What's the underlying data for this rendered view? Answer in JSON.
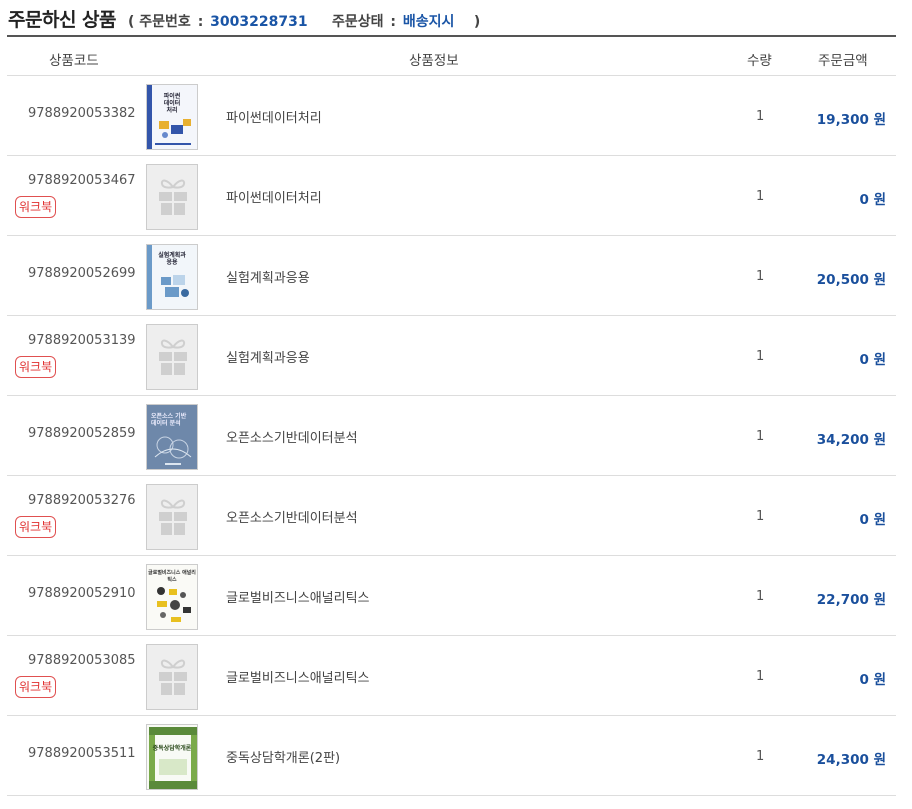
{
  "header": {
    "title": "주문하신 상품",
    "open_paren": "(",
    "order_no_label": "주문번호",
    "order_no": "3003228731",
    "status_label": "주문상태",
    "status": "배송지시",
    "close_paren": ")",
    "colon": ":"
  },
  "columns": {
    "code": "상품코드",
    "info": "상품정보",
    "qty": "수량",
    "price": "주문금액"
  },
  "rows": [
    {
      "code": "9788920053382",
      "name": "파이썬데이터처리",
      "qty": "1",
      "price": "19,300 원",
      "cover_title": "파이썬\n데이터\n처리"
    },
    {
      "code": "9788920053467",
      "badge": "워크북",
      "name": "파이썬데이터처리",
      "qty": "1",
      "price": "0 원"
    },
    {
      "code": "9788920052699",
      "name": "실험계획과응용",
      "qty": "1",
      "price": "20,500 원",
      "cover_title": "실험계획과\n응용"
    },
    {
      "code": "9788920053139",
      "badge": "워크북",
      "name": "실험계획과응용",
      "qty": "1",
      "price": "0 원"
    },
    {
      "code": "9788920052859",
      "name": "오픈소스기반데이터분석",
      "qty": "1",
      "price": "34,200 원",
      "cover_title": "오픈소스 기반\n데이터 분석"
    },
    {
      "code": "9788920053276",
      "badge": "워크북",
      "name": "오픈소스기반데이터분석",
      "qty": "1",
      "price": "0 원"
    },
    {
      "code": "9788920052910",
      "name": "글로벌비즈니스애널리틱스",
      "qty": "1",
      "price": "22,700 원",
      "cover_title": "글로벌비즈니스 애널리틱스"
    },
    {
      "code": "9788920053085",
      "badge": "워크북",
      "name": "글로벌비즈니스애널리틱스",
      "qty": "1",
      "price": "0 원"
    },
    {
      "code": "9788920053511",
      "name": "중독상담학개론(2판)",
      "qty": "1",
      "price": "24,300 원",
      "cover_title": "중독상담학개론"
    }
  ]
}
